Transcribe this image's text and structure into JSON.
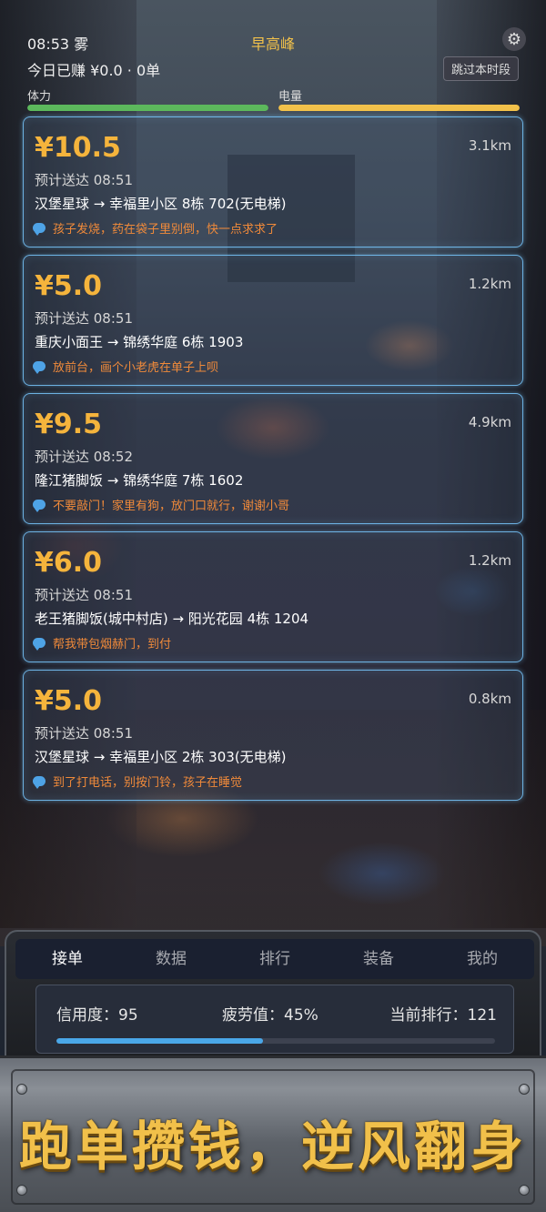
{
  "status": {
    "time_weather": "08:53 雾",
    "period": "早高峰",
    "earnings": "今日已赚 ¥0.0 · 0单",
    "skip_label": "跳过本时段",
    "stamina_label": "体力",
    "battery_label": "电量",
    "stamina_level": 1.0,
    "battery_level": 1.0
  },
  "orders": [
    {
      "price": "¥10.5",
      "distance": "3.1km",
      "eta": "预计送达 08:51",
      "route": "汉堡星球 → 幸福里小区 8栋 702(无电梯)",
      "note": "孩子发烧，药在袋子里别倒，快一点求求了"
    },
    {
      "price": "¥5.0",
      "distance": "1.2km",
      "eta": "预计送达 08:51",
      "route": "重庆小面王 → 锦绣华庭 6栋 1903",
      "note": "放前台，画个小老虎在单子上呗"
    },
    {
      "price": "¥9.5",
      "distance": "4.9km",
      "eta": "预计送达 08:52",
      "route": "隆江猪脚饭 → 锦绣华庭 7栋 1602",
      "note": "不要敲门！家里有狗，放门口就行，谢谢小哥"
    },
    {
      "price": "¥6.0",
      "distance": "1.2km",
      "eta": "预计送达 08:51",
      "route": "老王猪脚饭(城中村店) → 阳光花园 4栋 1204",
      "note": "帮我带包烟赫门，到付"
    },
    {
      "price": "¥5.0",
      "distance": "0.8km",
      "eta": "预计送达 08:51",
      "route": "汉堡星球 → 幸福里小区 2栋 303(无电梯)",
      "note": "到了打电话，别按门铃，孩子在睡觉"
    }
  ],
  "tabs": [
    "接单",
    "数据",
    "排行",
    "装备",
    "我的"
  ],
  "stats": {
    "credit": "信用度：95",
    "fatigue": "疲劳值：45%",
    "rank": "当前排行：121",
    "credit_level": 0.47
  },
  "banner": {
    "slogan": "跑单攒钱，逆风翻身"
  },
  "colors": {
    "price": "#f5b43c",
    "period": "#f2c14a",
    "stamina": "#5cb85c",
    "battery": "#f2c14a",
    "card_border": "#78c8ff",
    "note": "#f08a3a",
    "slogan": "#f1c04a"
  },
  "icons": {
    "settings": "gear-icon",
    "note": "message-icon"
  }
}
